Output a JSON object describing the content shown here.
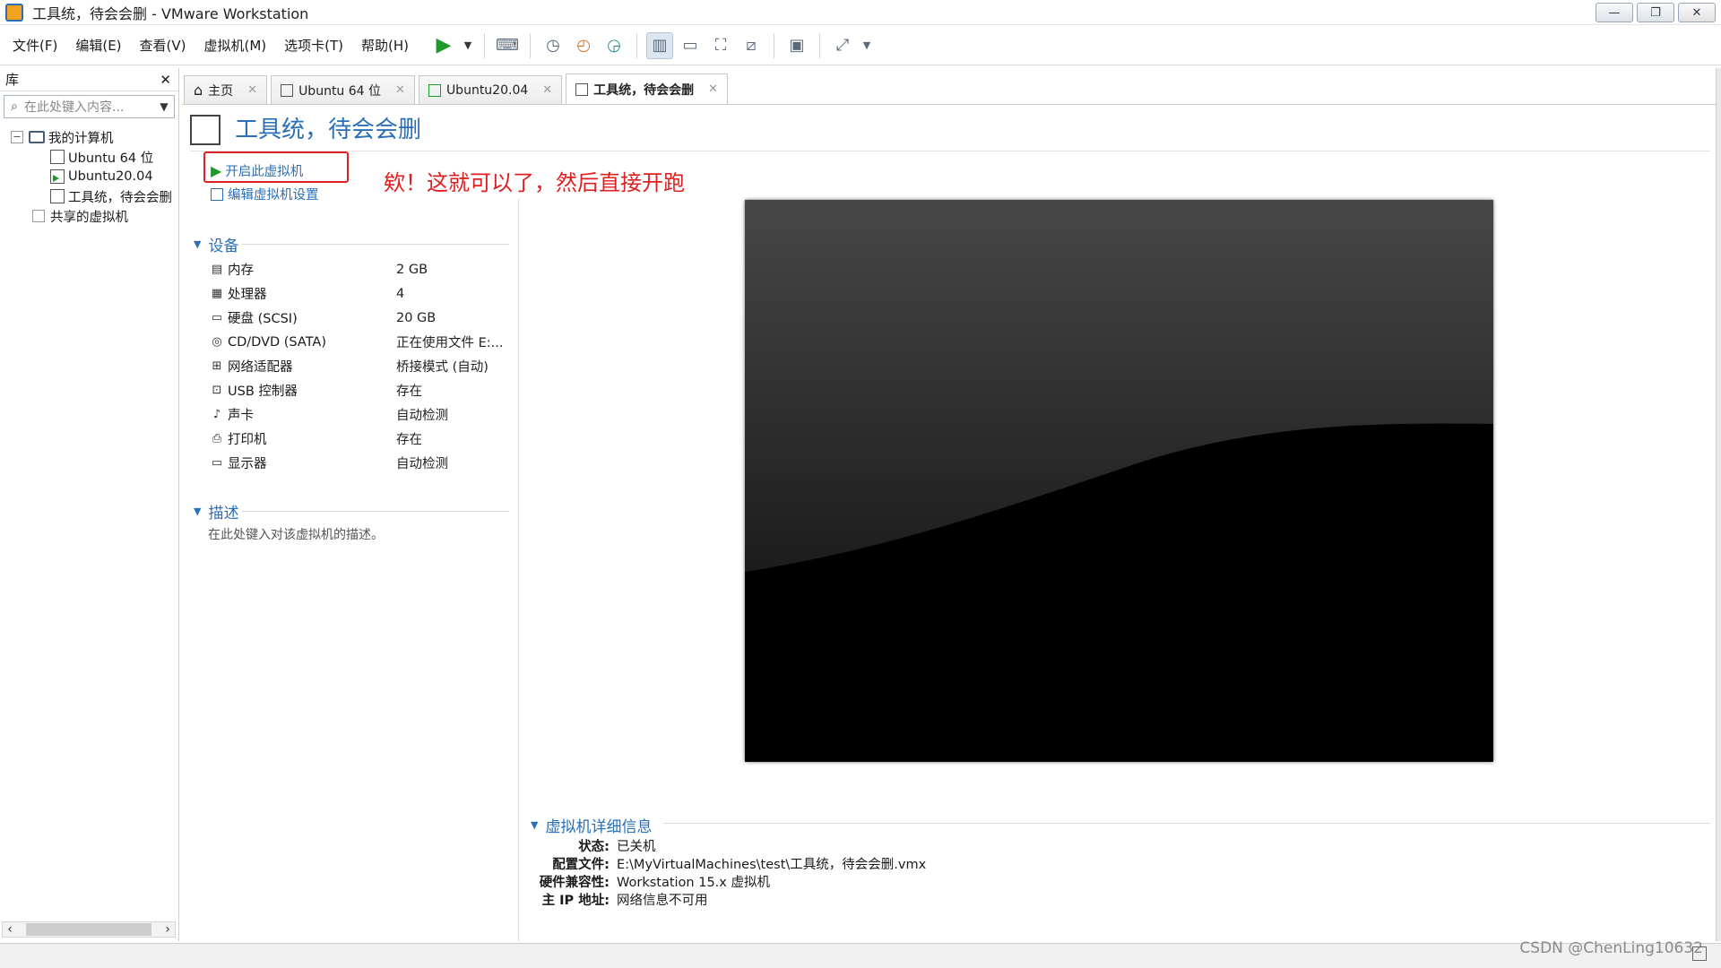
{
  "window": {
    "title": "工具统，待会会删 - VMware Workstation",
    "buttons": {
      "minimize": "—",
      "restore": "❐",
      "close": "✕"
    }
  },
  "menu": [
    "文件(F)",
    "编辑(E)",
    "查看(V)",
    "虚拟机(M)",
    "选项卡(T)",
    "帮助(H)"
  ],
  "toolbar_icons": [
    "play-icon",
    "dropdown-icon",
    "send-keys-icon",
    "snapshot-icon",
    "revert-snapshot-icon",
    "manage-snapshots-icon",
    "library-view-icon",
    "thumbnail-view-icon",
    "fullscreen-icon",
    "unity-icon",
    "console-icon",
    "stretch-icon"
  ],
  "library": {
    "title": "库",
    "close": "✕",
    "search_placeholder": "在此处键入内容...",
    "tree": {
      "root": "我的计算机",
      "vms": [
        "Ubuntu 64 位",
        "Ubuntu20.04",
        "工具统，待会会删"
      ],
      "shared": "共享的虚拟机"
    }
  },
  "tabs": [
    {
      "label": "主页",
      "icon": "home-icon"
    },
    {
      "label": "Ubuntu 64 位",
      "icon": "vm-icon"
    },
    {
      "label": "Ubuntu20.04",
      "icon": "vm-running-icon"
    },
    {
      "label": "工具统，待会会删",
      "icon": "vm-icon",
      "active": true
    }
  ],
  "vm": {
    "title": "工具统，待会会删",
    "actions": {
      "start": "开启此虚拟机",
      "edit": "编辑虚拟机设置"
    },
    "annotation": "欸！这就可以了，然后直接开跑",
    "devices_title": "设备",
    "devices": [
      {
        "icon": "memory-icon",
        "name": "内存",
        "value": "2 GB"
      },
      {
        "icon": "cpu-icon",
        "name": "处理器",
        "value": "4"
      },
      {
        "icon": "disk-icon",
        "name": "硬盘 (SCSI)",
        "value": "20 GB"
      },
      {
        "icon": "cd-icon",
        "name": "CD/DVD (SATA)",
        "value": "正在使用文件 E:..."
      },
      {
        "icon": "network-icon",
        "name": "网络适配器",
        "value": "桥接模式 (自动)"
      },
      {
        "icon": "usb-icon",
        "name": "USB 控制器",
        "value": "存在"
      },
      {
        "icon": "sound-icon",
        "name": "声卡",
        "value": "自动检测"
      },
      {
        "icon": "printer-icon",
        "name": "打印机",
        "value": "存在"
      },
      {
        "icon": "display-icon",
        "name": "显示器",
        "value": "自动检测"
      }
    ],
    "description_title": "描述",
    "description_placeholder": "在此处键入对该虚拟机的描述。",
    "details_title": "虚拟机详细信息",
    "details": [
      {
        "key": "状态:",
        "value": "已关机"
      },
      {
        "key": "配置文件:",
        "value": "E:\\MyVirtualMachines\\test\\工具统，待会会删.vmx"
      },
      {
        "key": "硬件兼容性:",
        "value": "Workstation 15.x 虚拟机"
      },
      {
        "key": "主 IP 地址:",
        "value": "网络信息不可用"
      }
    ]
  },
  "watermark": "CSDN @ChenLing10632"
}
